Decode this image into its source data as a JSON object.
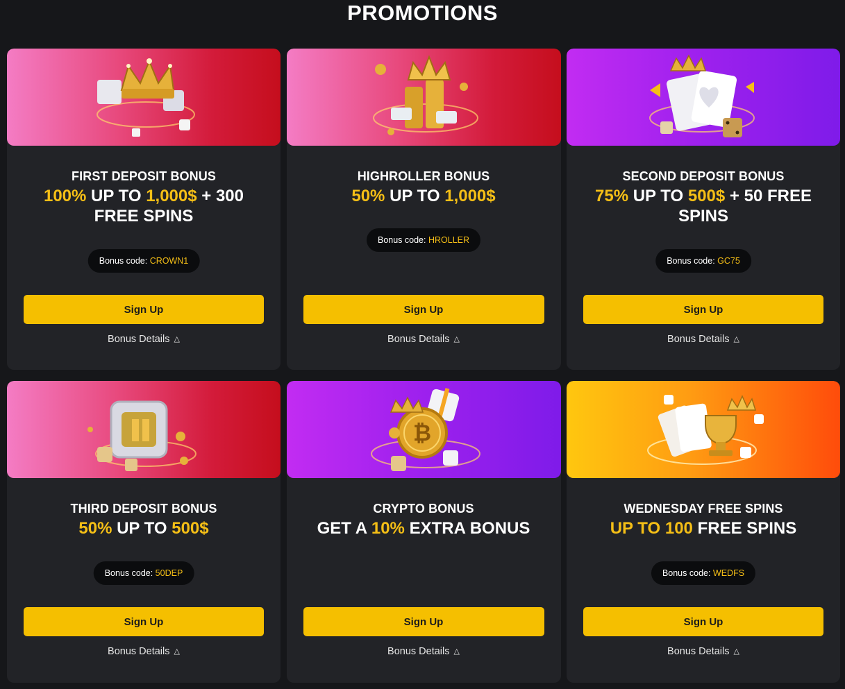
{
  "page": {
    "title": "PROMOTIONS"
  },
  "colors": {
    "background": "#16171a",
    "card": "#222327",
    "accent": "#f5bf16",
    "button": "#f5bf00"
  },
  "cards": [
    {
      "title": "FIRST DEPOSIT BONUS",
      "headline": {
        "p1": "100%",
        "p2": " UP TO ",
        "p3": "1,000$",
        "p4": " + 300 FREE SPINS"
      },
      "bonus_code_label": "Bonus code: ",
      "bonus_code": "CROWN1",
      "signup_label": "Sign Up",
      "details_label": "Bonus Details",
      "banner_icon": "golden-crown-gifts-icon",
      "banner_color": "pink-red"
    },
    {
      "title": "HIGHROLLER BONUS",
      "headline": {
        "p1": "50%",
        "p2": " UP TO ",
        "p3": "1,000$",
        "p4": ""
      },
      "bonus_code_label": "Bonus code: ",
      "bonus_code": "HROLLER",
      "signup_label": "Sign Up",
      "details_label": "Bonus Details",
      "banner_icon": "coin-stack-crown-icon",
      "banner_color": "pink-red"
    },
    {
      "title": "SECOND DEPOSIT BONUS",
      "headline": {
        "p1": "75%",
        "p2": " UP TO ",
        "p3": "500$",
        "p4": " + 50 FREE SPINS"
      },
      "bonus_code_label": "Bonus code: ",
      "bonus_code": "GC75",
      "signup_label": "Sign Up",
      "details_label": "Bonus Details",
      "banner_icon": "playing-cards-dice-icon",
      "banner_color": "purple"
    },
    {
      "title": "THIRD DEPOSIT BONUS",
      "headline": {
        "p1": "50%",
        "p2": " UP TO ",
        "p3": "500$",
        "p4": ""
      },
      "bonus_code_label": "Bonus code: ",
      "bonus_code": "50DEP",
      "signup_label": "Sign Up",
      "details_label": "Bonus Details",
      "banner_icon": "treasure-safe-icon",
      "banner_color": "pink-red"
    },
    {
      "title": "CRYPTO BONUS",
      "headline": {
        "p1": "GET A ",
        "p2": "10%",
        "p3": " EXTRA BONUS",
        "p4": ""
      },
      "signup_label": "Sign Up",
      "details_label": "Bonus Details",
      "banner_icon": "bitcoin-coin-icon",
      "banner_color": "purple"
    },
    {
      "title": "WEDNESDAY FREE SPINS",
      "headline": {
        "p1": "UP TO 100",
        "p2": " FREE SPINS",
        "p3": "",
        "p4": ""
      },
      "bonus_code_label": "Bonus code: ",
      "bonus_code": "WEDFS",
      "signup_label": "Sign Up",
      "details_label": "Bonus Details",
      "banner_icon": "trophy-cards-icon",
      "banner_color": "orange"
    }
  ]
}
